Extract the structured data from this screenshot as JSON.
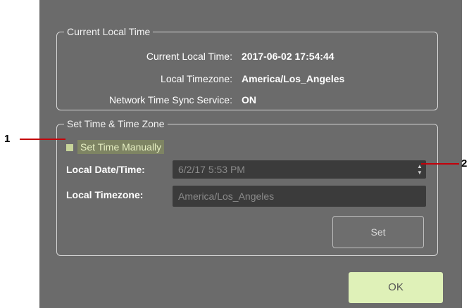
{
  "current_group": {
    "legend": "Current Local Time",
    "rows": [
      {
        "label": "Current Local Time:",
        "value": "2017-06-02 17:54:44"
      },
      {
        "label": "Local Timezone:",
        "value": "America/Los_Angeles"
      },
      {
        "label": "Network Time Sync Service:",
        "value": "ON"
      }
    ]
  },
  "set_group": {
    "legend": "Set Time & Time Zone",
    "checkbox_label": "Set Time Manually",
    "datetime_label": "Local Date/Time:",
    "datetime_value": "6/2/17 5:53 PM",
    "timezone_label": "Local Timezone:",
    "timezone_value": "America/Los_Angeles",
    "set_label": "Set"
  },
  "ok_label": "OK",
  "callouts": {
    "one": "1",
    "two": "2"
  },
  "colors": {
    "callout_line": "#c4000a",
    "ok_button": "#dff1b8",
    "checkbox": "#c7d59a"
  }
}
